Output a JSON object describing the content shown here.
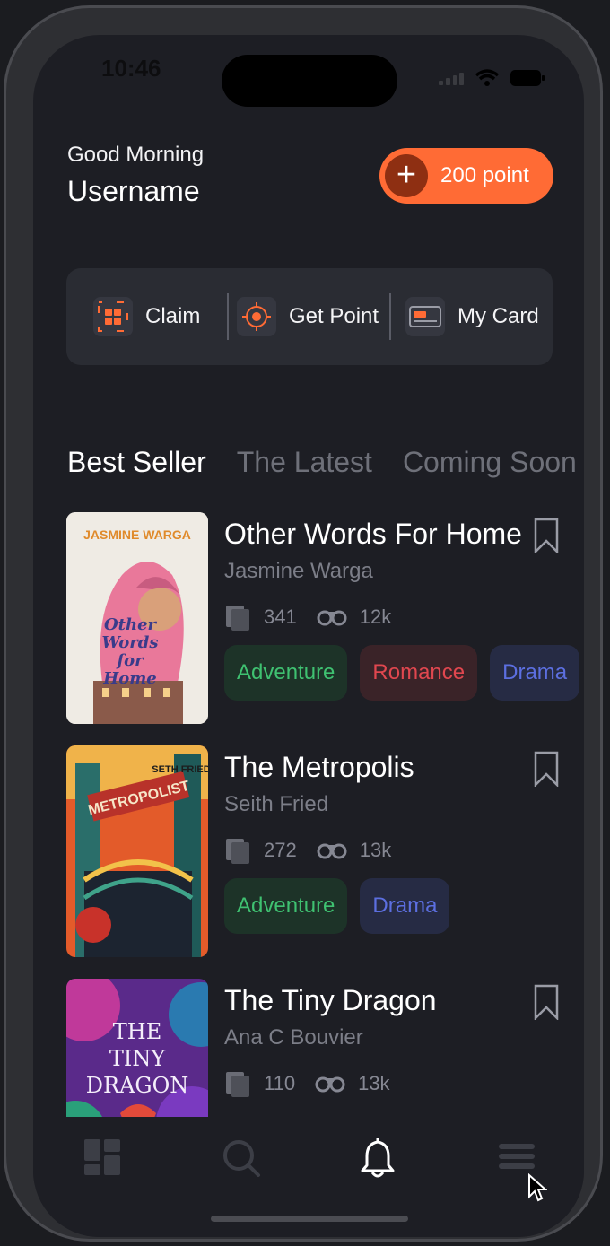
{
  "status": {
    "time": "10:46"
  },
  "header": {
    "greeting": "Good Morning",
    "username": "Username",
    "points_label": "200 point"
  },
  "quick_actions": [
    {
      "label": "Claim",
      "icon": "claim-grid-icon"
    },
    {
      "label": "Get Point",
      "icon": "crosshair-icon"
    },
    {
      "label": "My Card",
      "icon": "card-icon"
    }
  ],
  "tabs": [
    "Best Seller",
    "The Latest",
    "Coming Soon"
  ],
  "books": [
    {
      "title": "Other Words For Home",
      "author": "Jasmine Warga",
      "pages": "341",
      "views": "12k",
      "cover_title": "Other Words for Home",
      "cover_author": "JASMINE WARGA",
      "tags": [
        {
          "label": "Adventure",
          "kind": "adv"
        },
        {
          "label": "Romance",
          "kind": "rom"
        },
        {
          "label": "Drama",
          "kind": "dra"
        }
      ]
    },
    {
      "title": "The Metropolis",
      "author": "Seith Fried",
      "pages": "272",
      "views": "13k",
      "cover_title": "METROPOLIST",
      "cover_author": "SETH FRIED",
      "tags": [
        {
          "label": "Adventure",
          "kind": "adv"
        },
        {
          "label": "Drama",
          "kind": "dra"
        }
      ]
    },
    {
      "title": "The Tiny Dragon",
      "author": "Ana C Bouvier",
      "pages": "110",
      "views": "13k",
      "cover_title": "THE TINY DRAGON",
      "cover_author": "",
      "tags": []
    }
  ],
  "colors": {
    "accent": "#ff6b35",
    "adventure": "#3fc171",
    "romance": "#e0474f",
    "drama": "#5c6fe0",
    "background": "#1d1e24"
  },
  "bottom_nav": [
    {
      "name": "home",
      "icon": "dashboard-icon"
    },
    {
      "name": "search",
      "icon": "search-icon"
    },
    {
      "name": "notifications",
      "icon": "bell-icon",
      "active": true
    },
    {
      "name": "menu",
      "icon": "menu-icon"
    }
  ]
}
